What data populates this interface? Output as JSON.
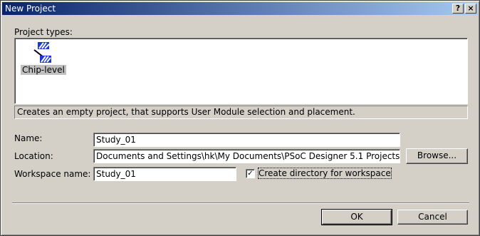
{
  "window": {
    "title": "New Project",
    "help_glyph": "?",
    "close_glyph": "×"
  },
  "project_types": {
    "label": "Project types:",
    "items": [
      {
        "label": "Chip-level",
        "icon": "chip-level-icon",
        "selected": true
      }
    ],
    "description": "Creates an empty project, that supports User Module selection and placement."
  },
  "form": {
    "name_label": "Name:",
    "name_value": "Study_01",
    "location_label": "Location:",
    "location_value": "Documents and Settings\\hk\\My Documents\\PSoC Designer 5.1 Projects",
    "workspace_label": "Workspace name:",
    "workspace_value": "Study_01",
    "browse_label": "Browse...",
    "create_dir_label": "Create directory for workspace",
    "create_dir_checked": true
  },
  "buttons": {
    "ok_label": "OK",
    "cancel_label": "Cancel"
  },
  "colors": {
    "titlebar_start": "#0a246a",
    "titlebar_end": "#a6caf0",
    "dialog_face": "#d4d0c8"
  }
}
